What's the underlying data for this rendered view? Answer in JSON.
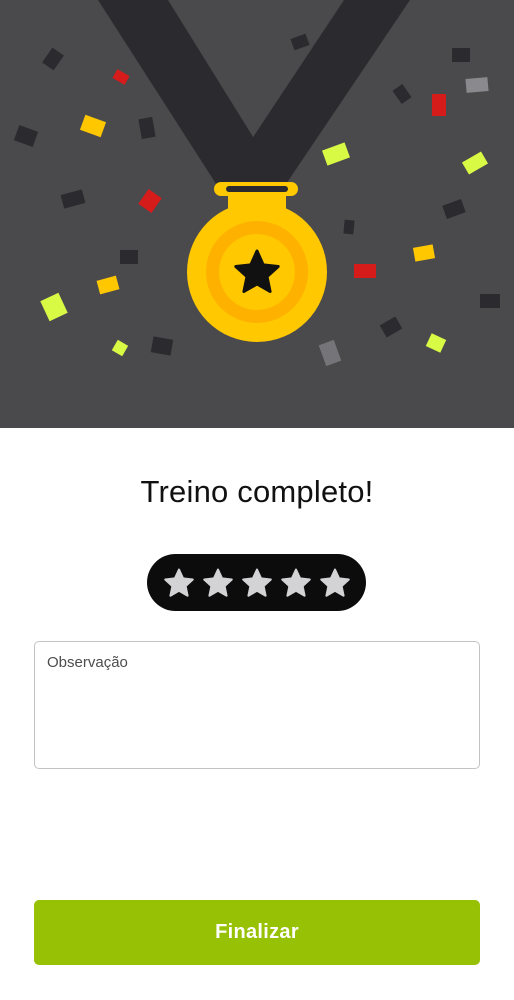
{
  "hero": {
    "illustration": "medal-with-ribbon-and-confetti",
    "medal_icon": "star-icon",
    "colors": {
      "background": "#4a494c",
      "ribbon": "#2b2a2e",
      "medal_outer": "#ffc800",
      "medal_ring": "#ffb100",
      "confetti_yellow": "#ffc700",
      "confetti_lime": "#d8fa45",
      "confetti_red": "#d61b1b"
    }
  },
  "title": "Treino completo!",
  "rating": {
    "max": 5,
    "value": 0,
    "icon": "star-icon",
    "star_color": "#d3d3d6",
    "background": "#0c0c0c"
  },
  "observation": {
    "placeholder": "Observação",
    "value": ""
  },
  "finish_button": {
    "label": "Finalizar",
    "color": "#97c104"
  }
}
